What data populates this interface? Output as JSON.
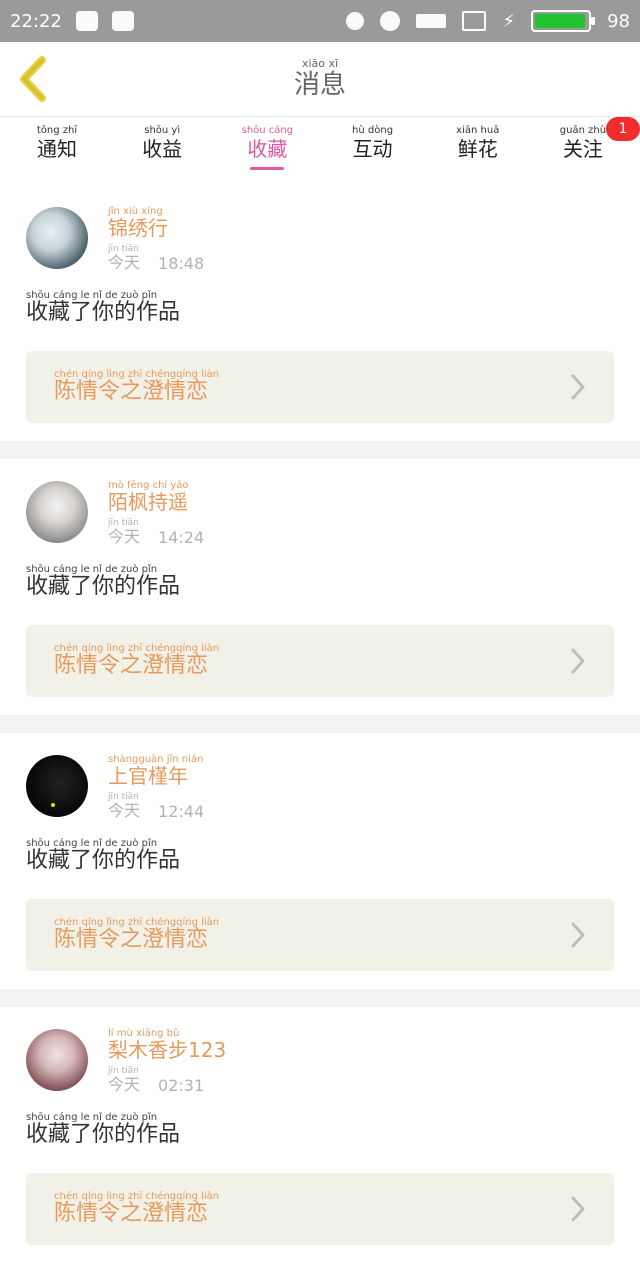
{
  "status_bar": {
    "time": "22:22",
    "battery": "98",
    "icons": [
      "qq-icon",
      "image-icon",
      "muted-bell-icon",
      "alarm-icon",
      "signal-icon",
      "screen-icon",
      "charging-icon",
      "battery-icon"
    ],
    "battery_color": "#22c32e"
  },
  "header": {
    "title_pinyin": "xiāo  xī",
    "title": "消息",
    "back_icon": "chevron-left-icon"
  },
  "tabs": [
    {
      "pinyin": "tōng zhī",
      "label": "通知"
    },
    {
      "pinyin": "shōu yì",
      "label": "收益"
    },
    {
      "pinyin": "shōu cáng",
      "label": "收藏"
    },
    {
      "pinyin": "hù dòng",
      "label": "互动"
    },
    {
      "pinyin": "xiān huā",
      "label": "鲜花"
    },
    {
      "pinyin": "guān zhù",
      "label": "关注"
    }
  ],
  "active_tab_index": 2,
  "follow_badge": "1",
  "messages": [
    {
      "user_pinyin": "jǐn xiù xíng",
      "user": "锦绣行",
      "time_pinyin": "jīn tiān",
      "time_day": "今天",
      "time": "18:48",
      "action_pinyin": "shōu cáng  le   nǐ   de  zuò  pǐn",
      "action": "收藏了你的作品",
      "work_pinyin": "chén qíng lìng zhī chéngqíng liàn",
      "work": "陈情令之澄情恋"
    },
    {
      "user_pinyin": "mò fēng chí yáo",
      "user": "陌枫持遥",
      "time_pinyin": "jīn tiān",
      "time_day": "今天",
      "time": "14:24",
      "action_pinyin": "shōu cáng  le   nǐ   de  zuò  pǐn",
      "action": "收藏了你的作品",
      "work_pinyin": "chén qíng lìng zhī chéngqíng liàn",
      "work": "陈情令之澄情恋"
    },
    {
      "user_pinyin": "shàngguān jǐn nián",
      "user": "上官槿年",
      "time_pinyin": "jīn tiān",
      "time_day": "今天",
      "time": "12:44",
      "action_pinyin": "shōu cáng  le   nǐ   de  zuò  pǐn",
      "action": "收藏了你的作品",
      "work_pinyin": "chén qíng lìng zhī chéngqíng liàn",
      "work": "陈情令之澄情恋"
    },
    {
      "user_pinyin": "lí mù xiāng bǔ",
      "user": "梨木香步123",
      "time_pinyin": "jīn tiān",
      "time_day": "今天",
      "time": "02:31",
      "action_pinyin": "shōu cáng  le   nǐ   de  zuò  pǐn",
      "action": "收藏了你的作品",
      "work_pinyin": "chén qíng lìng zhī chéngqíng liàn",
      "work": "陈情令之澄情恋"
    }
  ]
}
